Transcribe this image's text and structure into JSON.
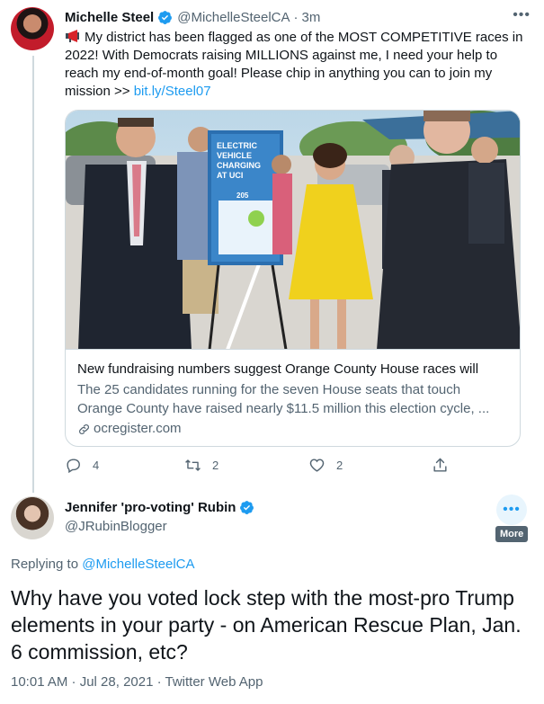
{
  "tweet1": {
    "name": "Michelle Steel",
    "handle": "@MichelleSteelCA",
    "time": "3m",
    "text": "My district has been flagged as one of the MOST COMPETITIVE races in 2022! With Democrats raising MILLIONS against me, I need your help to reach my end-of-month goal! Please chip in anything you can to join my mission >> ",
    "link_text": "bit.ly/Steel07",
    "card": {
      "image_sign_text": "ELECTRIC VEHICLE CHARGING AT UCI",
      "image_sign_number": "205",
      "title": "New fundraising numbers suggest Orange County House races will",
      "description": "The 25 candidates running for the seven House seats that touch Orange County have raised nearly $11.5 million this election cycle, ...",
      "domain": "ocregister.com"
    },
    "actions": {
      "replies": "4",
      "retweets": "2",
      "likes": "2"
    }
  },
  "tweet2": {
    "name": "Jennifer 'pro-voting' Rubin",
    "handle": "@JRubinBlogger",
    "more_tooltip": "More",
    "replying_to_prefix": "Replying to ",
    "replying_to_handle": "@MichelleSteelCA",
    "text": "Why have you voted lock step with the most-pro Trump elements in your party - on American Rescue Plan, Jan. 6 commission, etc?",
    "timestamp": "10:01 AM · Jul 28, 2021 · Twitter Web App"
  },
  "colors": {
    "accent": "#1d9bf0",
    "muted": "#536471",
    "border": "#cfd9de",
    "text": "#0f1419"
  },
  "icons": [
    "verified-badge-icon",
    "megaphone-icon",
    "link-icon",
    "reply-icon",
    "retweet-icon",
    "like-icon",
    "share-icon",
    "more-icon"
  ]
}
